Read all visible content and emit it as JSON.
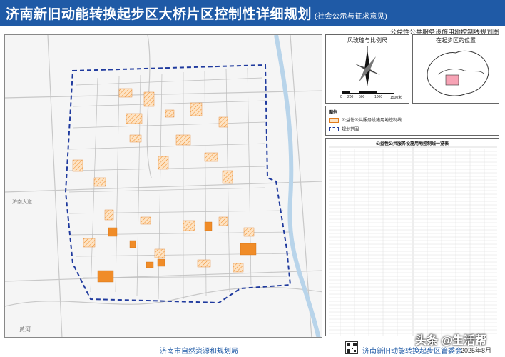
{
  "header": {
    "title": "济南新旧动能转换起步区大桥片区控制性详细规划",
    "title_note": "(社会公示与征求意见)",
    "map_subtitle": "公益性公共服务设施用地控制线规划图"
  },
  "panels": {
    "compass_title": "风玫瑰与比例尺",
    "location_title": "在起步区的位置",
    "scale_labels": [
      "0",
      "200",
      "500",
      "1000",
      "1500米"
    ]
  },
  "legend": {
    "heading": "图例",
    "items": [
      {
        "label": "公益性公共服务设施用地控制线",
        "color": "#f4a460"
      },
      {
        "label": "规划范围",
        "color": "#1f3a9e"
      }
    ]
  },
  "table": {
    "title": "公益性公共服务设施用地控制线一览表"
  },
  "map_labels": {
    "road_1": "黄河",
    "road_2": "济南大道"
  },
  "footer": {
    "org_left": "济南市自然资源和规划局",
    "org_right": "济南新旧动能转换起步区管委会",
    "date": "2025年8月"
  },
  "watermark": "头条 @生活帮",
  "colors": {
    "header_bg": "#1f5aa6",
    "facility": "#f4a460",
    "facility_solid": "#f08c28",
    "boundary": "#1f3a9e"
  }
}
